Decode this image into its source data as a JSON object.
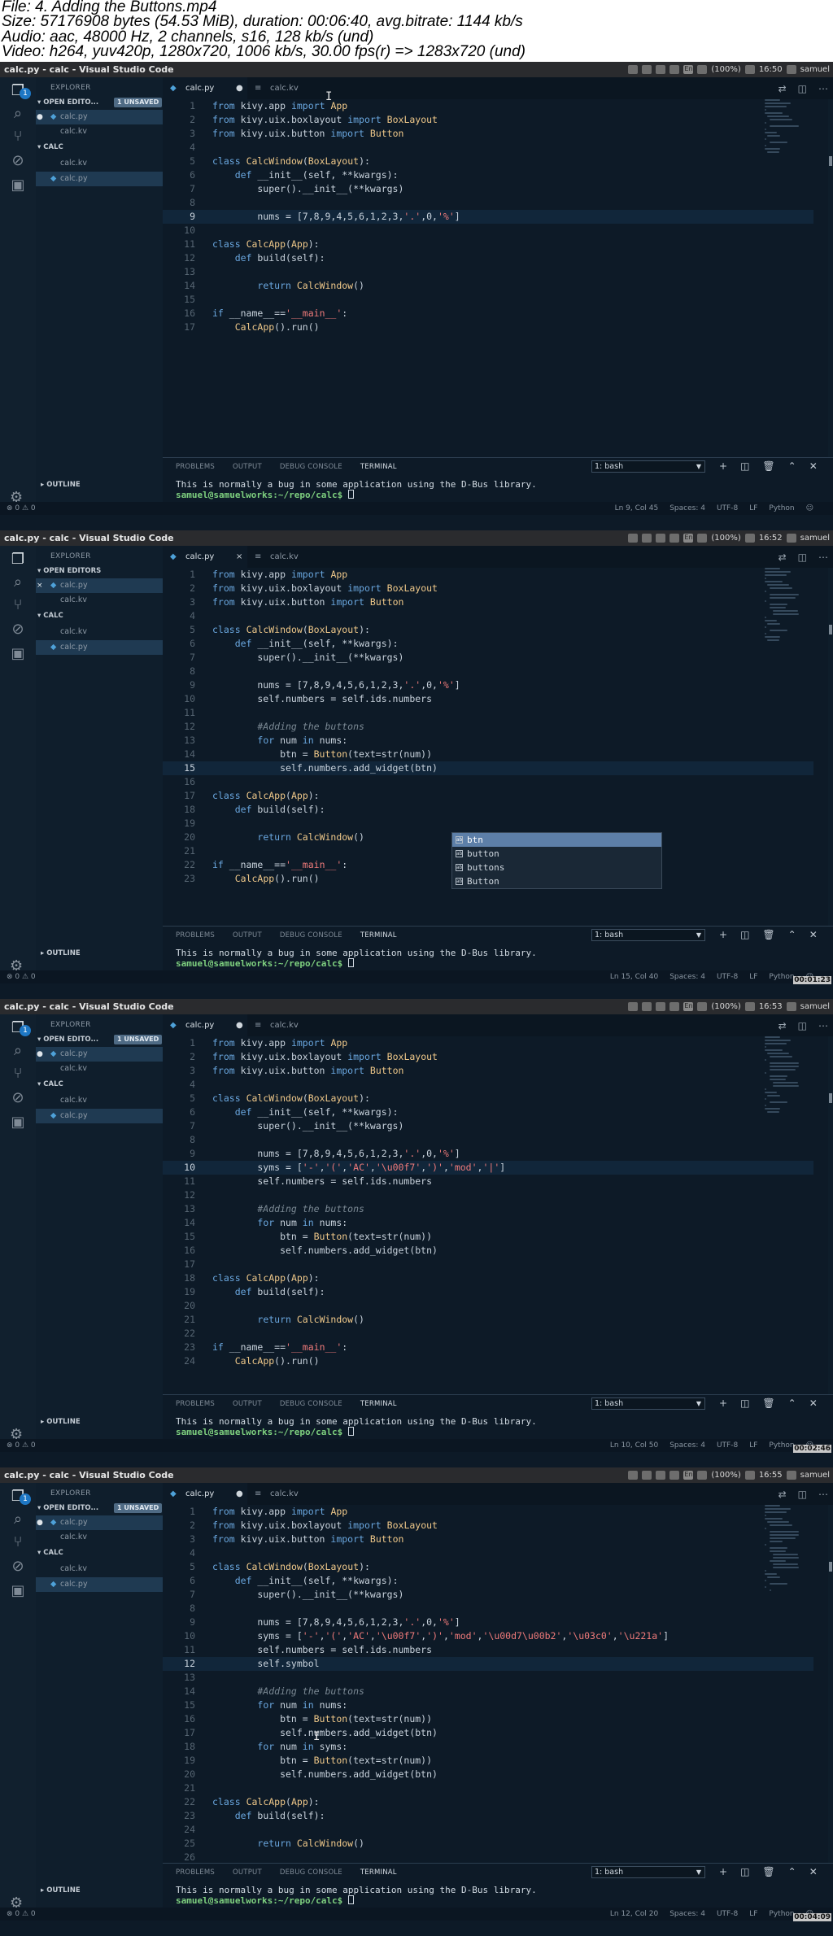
{
  "header": {
    "file": "File: 4. Adding the Buttons.mp4",
    "size": "Size: 57176908 bytes (54.53 MiB), duration: 00:06:40, avg.bitrate: 1144 kb/s",
    "audio": "Audio: aac, 48000 Hz, 2 channels, s16, 128 kb/s (und)",
    "video": "Video: h264, yuv420p, 1280x720, 1006 kb/s, 30.00 fps(r) => 1283x720 (und)"
  },
  "frames": [
    {
      "window_title": "calc.py - calc - Visual Studio Code",
      "clock": "16:50",
      "battery": "(100%)",
      "user": "samuel",
      "tab1": "calc.py",
      "tab1_marker": "●",
      "tab2": "calc.kv",
      "explorer_title": "EXPLORER",
      "open_editors": "OPEN EDITO...",
      "unsaved": "1 UNSAVED",
      "open1": "calc.py",
      "open1_marker": "●",
      "open2": "calc.kv",
      "folder": "CALC",
      "file1": "calc.kv",
      "file2": "calc.py",
      "outline": "OUTLINE",
      "panel_problems": "PROBLEMS",
      "panel_output": "OUTPUT",
      "panel_debug": "DEBUG CONSOLE",
      "panel_terminal": "TERMINAL",
      "shell": "1: bash",
      "term_line": "This is normally a bug in some application using the D-Bus library.",
      "term_prompt": "samuel@samuelworks:~/repo/calc$",
      "status_left": "⊗ 0 ⚠ 0",
      "pos": "Ln 9, Col 45",
      "spaces": "Spaces: 4",
      "enc": "UTF-8",
      "eol": "LF",
      "lang": "Python",
      "timestamp": "",
      "code": [
        "from kivy.app import App",
        "from kivy.uix.boxlayout import BoxLayout",
        "from kivy.uix.button import Button",
        "",
        "class CalcWindow(BoxLayout):",
        "    def __init__(self, **kwargs):",
        "        super().__init__(**kwargs)",
        "",
        "        nums = [7,8,9,4,5,6,1,2,3,'.',0,'%']",
        "",
        "class CalcApp(App):",
        "    def build(self):",
        "",
        "        return CalcWindow()",
        "",
        "if __name__=='__main__':",
        "    CalcApp().run()"
      ],
      "current_line": 9,
      "suggestions": []
    },
    {
      "window_title": "calc.py - calc - Visual Studio Code",
      "clock": "16:52",
      "battery": "(100%)",
      "user": "samuel",
      "tab1": "calc.py",
      "tab1_marker": "×",
      "tab2": "calc.kv",
      "explorer_title": "EXPLORER",
      "open_editors": "OPEN EDITORS",
      "unsaved": "",
      "open1": "calc.py",
      "open1_marker": "×",
      "open2": "calc.kv",
      "folder": "CALC",
      "file1": "calc.kv",
      "file2": "calc.py",
      "outline": "OUTLINE",
      "panel_problems": "PROBLEMS",
      "panel_output": "OUTPUT",
      "panel_debug": "DEBUG CONSOLE",
      "panel_terminal": "TERMINAL",
      "shell": "1: bash",
      "term_line": "This is normally a bug in some application using the D-Bus library.",
      "term_prompt": "samuel@samuelworks:~/repo/calc$",
      "status_left": "⊗ 0 ⚠ 0",
      "pos": "Ln 15, Col 40",
      "spaces": "Spaces: 4",
      "enc": "UTF-8",
      "eol": "LF",
      "lang": "Python",
      "timestamp": "00:01:23",
      "code": [
        "from kivy.app import App",
        "from kivy.uix.boxlayout import BoxLayout",
        "from kivy.uix.button import Button",
        "",
        "class CalcWindow(BoxLayout):",
        "    def __init__(self, **kwargs):",
        "        super().__init__(**kwargs)",
        "",
        "        nums = [7,8,9,4,5,6,1,2,3,'.',0,'%']",
        "        self.numbers = self.ids.numbers",
        "",
        "        #Adding the buttons",
        "        for num in nums:",
        "            btn = Button(text=str(num))",
        "            self.numbers.add_widget(btn)",
        "",
        "class CalcApp(App):",
        "    def build(self):",
        "",
        "        return CalcWindow()",
        "",
        "if __name__=='__main__':",
        "    CalcApp().run()"
      ],
      "current_line": 15,
      "suggestions": [
        "btn",
        "button",
        "buttons",
        "Button"
      ]
    },
    {
      "window_title": "calc.py - calc - Visual Studio Code",
      "clock": "16:53",
      "battery": "(100%)",
      "user": "samuel",
      "tab1": "calc.py",
      "tab1_marker": "●",
      "tab2": "calc.kv",
      "explorer_title": "EXPLORER",
      "open_editors": "OPEN EDITO...",
      "unsaved": "1 UNSAVED",
      "open1": "calc.py",
      "open1_marker": "●",
      "open2": "calc.kv",
      "folder": "CALC",
      "file1": "calc.kv",
      "file2": "calc.py",
      "outline": "OUTLINE",
      "panel_problems": "PROBLEMS",
      "panel_output": "OUTPUT",
      "panel_debug": "DEBUG CONSOLE",
      "panel_terminal": "TERMINAL",
      "shell": "1: bash",
      "term_line": "This is normally a bug in some application using the D-Bus library.",
      "term_prompt": "samuel@samuelworks:~/repo/calc$",
      "status_left": "⊗ 0 ⚠ 0",
      "pos": "Ln 10, Col 50",
      "spaces": "Spaces: 4",
      "enc": "UTF-8",
      "eol": "LF",
      "lang": "Python",
      "timestamp": "00:02:46",
      "code": [
        "from kivy.app import App",
        "from kivy.uix.boxlayout import BoxLayout",
        "from kivy.uix.button import Button",
        "",
        "class CalcWindow(BoxLayout):",
        "    def __init__(self, **kwargs):",
        "        super().__init__(**kwargs)",
        "",
        "        nums = [7,8,9,4,5,6,1,2,3,'.',0,'%']",
        "        syms = ['-','(','AC','\\u00f7',')','mod','|']",
        "        self.numbers = self.ids.numbers",
        "",
        "        #Adding the buttons",
        "        for num in nums:",
        "            btn = Button(text=str(num))",
        "            self.numbers.add_widget(btn)",
        "",
        "class CalcApp(App):",
        "    def build(self):",
        "",
        "        return CalcWindow()",
        "",
        "if __name__=='__main__':",
        "    CalcApp().run()"
      ],
      "current_line": 10,
      "suggestions": []
    },
    {
      "window_title": "calc.py - calc - Visual Studio Code",
      "clock": "16:55",
      "battery": "(100%)",
      "user": "samuel",
      "tab1": "calc.py",
      "tab1_marker": "●",
      "tab2": "calc.kv",
      "explorer_title": "EXPLORER",
      "open_editors": "OPEN EDITO...",
      "unsaved": "1 UNSAVED",
      "open1": "calc.py",
      "open1_marker": "●",
      "open2": "calc.kv",
      "folder": "CALC",
      "file1": "calc.kv",
      "file2": "calc.py",
      "outline": "OUTLINE",
      "panel_problems": "PROBLEMS",
      "panel_output": "OUTPUT",
      "panel_debug": "DEBUG CONSOLE",
      "panel_terminal": "TERMINAL",
      "shell": "1: bash",
      "term_line": "This is normally a bug in some application using the D-Bus library.",
      "term_prompt": "samuel@samuelworks:~/repo/calc$",
      "status_left": "⊗ 0 ⚠ 0",
      "pos": "Ln 12, Col 20",
      "spaces": "Spaces: 4",
      "enc": "UTF-8",
      "eol": "LF",
      "lang": "Python",
      "timestamp": "00:04:09",
      "code": [
        "from kivy.app import App",
        "from kivy.uix.boxlayout import BoxLayout",
        "from kivy.uix.button import Button",
        "",
        "class CalcWindow(BoxLayout):",
        "    def __init__(self, **kwargs):",
        "        super().__init__(**kwargs)",
        "",
        "        nums = [7,8,9,4,5,6,1,2,3,'.',0,'%']",
        "        syms = ['-','(','AC','\\u00f7',')','mod','\\u00d7\\u00b2','\\u03c0','\\u221a']",
        "        self.numbers = self.ids.numbers",
        "        self.symbol",
        "",
        "        #Adding the buttons",
        "        for num in nums:",
        "            btn = Button(text=str(num))",
        "            self.numbers.add_widget(btn)",
        "        for num in syms:",
        "            btn = Button(text=str(num))",
        "            self.numbers.add_widget(btn)",
        "",
        "class CalcApp(App):",
        "    def build(self):",
        "",
        "        return CalcWindow()",
        "",
        "        "
      ],
      "current_line": 12,
      "suggestions": []
    }
  ]
}
